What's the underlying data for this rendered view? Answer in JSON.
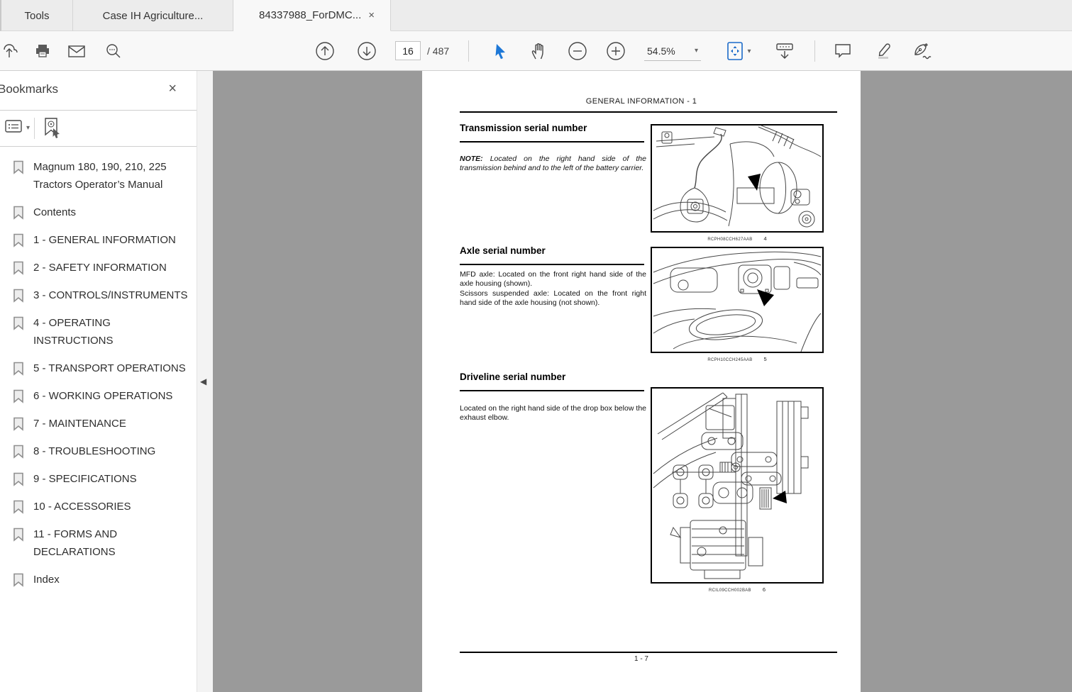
{
  "icons": {
    "close": "×",
    "caret_down": "▾",
    "collapse_left": "◀"
  },
  "colors": {
    "accent": "#1b6ac9",
    "canvas": "#9a9a9a"
  },
  "tabs": [
    {
      "label": "Tools"
    },
    {
      "label": "Case IH Agriculture..."
    },
    {
      "label": "84337988_ForDMC..."
    }
  ],
  "toolbar": {
    "page_current": "16",
    "page_total": "/ 487",
    "zoom_level": "54.5%"
  },
  "sidebar": {
    "title": "Bookmarks",
    "items": [
      {
        "label": "Magnum 180, 190, 210, 225 Tractors Operator’s Manual"
      },
      {
        "label": "Contents"
      },
      {
        "label": "1 - GENERAL INFORMATION"
      },
      {
        "label": "2 - SAFETY INFORMATION"
      },
      {
        "label": "3 - CONTROLS/INSTRUMENTS"
      },
      {
        "label": "4 - OPERATING INSTRUCTIONS"
      },
      {
        "label": "5 - TRANSPORT OPERATIONS"
      },
      {
        "label": "6 - WORKING OPERATIONS"
      },
      {
        "label": "7 - MAINTENANCE"
      },
      {
        "label": "8 - TROUBLESHOOTING"
      },
      {
        "label": "9 - SPECIFICATIONS"
      },
      {
        "label": "10 - ACCESSORIES"
      },
      {
        "label": "11 - FORMS AND DECLARATIONS"
      },
      {
        "label": "Index"
      }
    ]
  },
  "document": {
    "header": "GENERAL INFORMATION - 1",
    "footer": "1 - 7",
    "sections": [
      {
        "heading": "Transmission serial number",
        "note_prefix": "NOTE:",
        "note_text": " Located on the right hand side of the transmission behind and to the left of the battery carrier.",
        "figure_code": "RCPH08CCH627AAB",
        "figure_number": "4"
      },
      {
        "heading": "Axle serial number",
        "para1": "MFD axle: Located on the front right hand side of the axle housing (shown).",
        "para2": "Scissors suspended axle: Located on the front right hand side of the axle housing (not shown).",
        "figure_code": "RCPH10CCH245AAB",
        "figure_number": "5"
      },
      {
        "heading": "Driveline serial number",
        "para1": "Located on the right hand side of the drop box below the exhaust elbow.",
        "figure_code": "RCIL09CCH002BAB",
        "figure_number": "6"
      }
    ]
  }
}
